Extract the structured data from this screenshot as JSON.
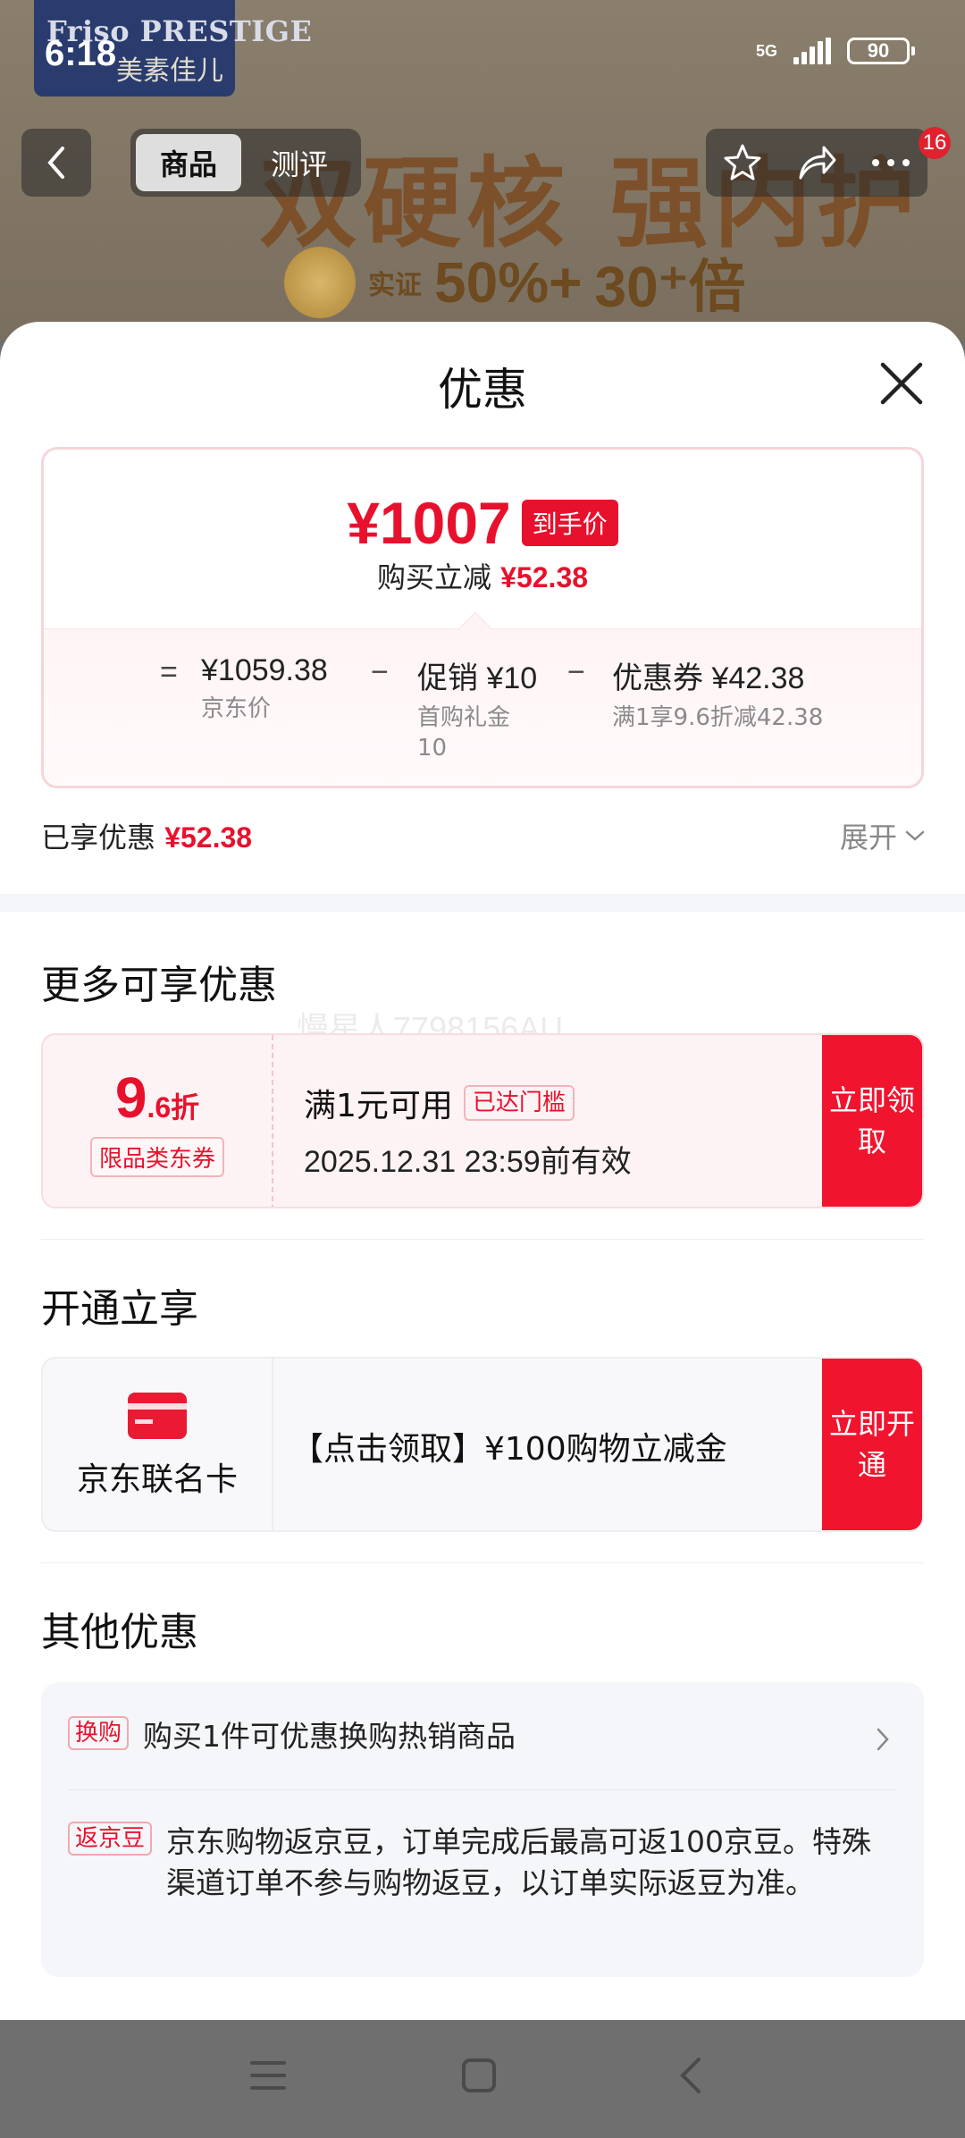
{
  "status_bar": {
    "time": "6:18",
    "network": "5G",
    "battery": "90"
  },
  "background": {
    "brand": {
      "line1": "Friso PRESTIGE",
      "line2": "美素佳儿"
    },
    "hero_title": "双硬核 强内护",
    "hero_claim_prefix": "实证",
    "hero_value_1": "50%+",
    "hero_value_2": "30⁺倍",
    "tabs": [
      {
        "label": "商品"
      },
      {
        "label": "测评"
      }
    ],
    "cart_badge": "16"
  },
  "sheet": {
    "title": "优惠",
    "price": {
      "final": "¥1007",
      "final_tag": "到手价",
      "save_label": "购买立减",
      "save_value": "¥52.38",
      "breakdown": [
        {
          "op": "=",
          "amount": "¥1059.38",
          "desc": "京东价"
        },
        {
          "op": "−",
          "amount": "促销 ¥10",
          "desc": "首购礼金10"
        },
        {
          "op": "−",
          "amount": "优惠券 ¥42.38",
          "desc": "满1享9.6折减42.38"
        }
      ]
    },
    "enjoyed_label": "已享优惠",
    "enjoyed_value": "¥52.38",
    "expand_label": "展开",
    "more_title": "更多可享优惠",
    "watermark": "慢星人7798156AU",
    "coupon": {
      "discount_int": "9",
      "discount_frac": ".6折",
      "type": "限品类东券",
      "condition": "满1元可用",
      "reached": "已达门槛",
      "valid": "2025.12.31 23:59前有效",
      "action": "立即领取"
    },
    "open_title": "开通立享",
    "card_offer": {
      "name": "京东联名卡",
      "text": "【点击领取】¥100购物立减金",
      "action": "立即开通"
    },
    "other_title": "其他优惠",
    "other_items": [
      {
        "tag": "换购",
        "text": "购买1件可优惠换购热销商品"
      },
      {
        "tag": "返京豆",
        "text": "京东购物返京豆，订单完成后最高可返100京豆。特殊渠道订单不参与购物返豆，以订单实际返豆为准。"
      }
    ]
  },
  "colors": {
    "accent": "#e8112d",
    "button": "#f1142f"
  }
}
